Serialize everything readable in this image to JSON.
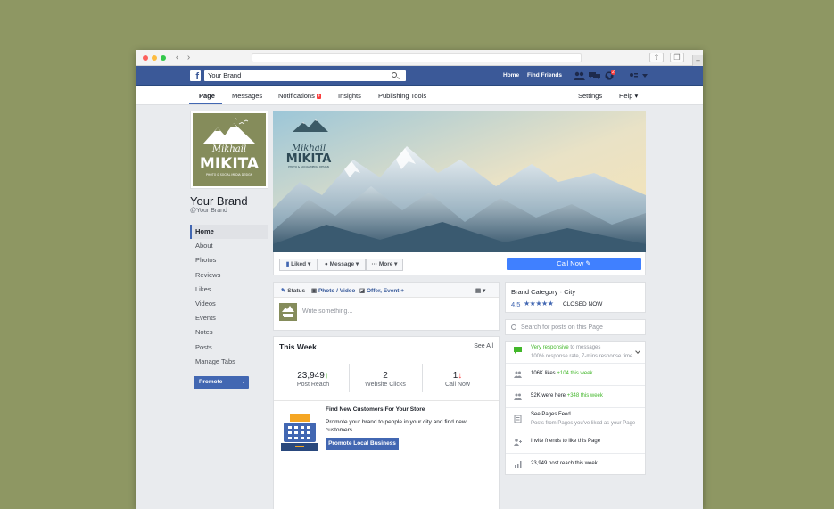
{
  "browser": {
    "tb_back": "‹",
    "tb_forward": "›",
    "tb_share": "⇧",
    "tb_tabs": "❐",
    "tb_new_tab": "+"
  },
  "fb_header": {
    "logo": "f",
    "search_value": "Your Brand",
    "nav_home": "Home",
    "nav_find_friends": "Find Friends",
    "globe_badge": "2",
    "colors": {
      "bar": "#3b5998",
      "accent": "#4267b2",
      "call_now": "#4080ff"
    }
  },
  "page_tabs": {
    "page": "Page",
    "messages": "Messages",
    "notifications": "Notifications",
    "notifications_count": "4",
    "insights": "Insights",
    "publishing_tools": "Publishing Tools",
    "settings": "Settings",
    "help": "Help ▾"
  },
  "profile": {
    "logo_first": "Mikhail",
    "logo_last": "MIKITA",
    "logo_tagline": "PHOTO & SOCIAL MEDIA DESIGN",
    "name": "Your Brand",
    "handle": "@Your Brand"
  },
  "left_nav": [
    "Home",
    "About",
    "Photos",
    "Reviews",
    "Likes",
    "Videos",
    "Events",
    "Notes",
    "Posts",
    "Manage Tabs"
  ],
  "promote_button": "Promote",
  "cover": {
    "logo_first": "Mikhail",
    "logo_last": "MIKITA",
    "logo_tagline": "PHOTO & SOCIAL MEDIA DESIGN"
  },
  "actions": {
    "liked": "Liked",
    "message": "Message",
    "more": "More",
    "call_now": "Call Now"
  },
  "composer": {
    "status": "Status",
    "photo_video": "Photo / Video",
    "offer_event": "Offer, Event +",
    "placeholder": "Write something..."
  },
  "this_week": {
    "title": "This Week",
    "see_all": "See All",
    "stats": [
      {
        "value": "23,949",
        "label": "Post Reach",
        "trend": "↑"
      },
      {
        "value": "2",
        "label": "Website Clicks",
        "trend": ""
      },
      {
        "value": "1",
        "label": "Call Now",
        "trend": "↓"
      }
    ],
    "find_title": "Find New Customers For Your Store",
    "find_desc": "Promote your brand to people in your city and find new customers",
    "promote_local": "Promote Local Business"
  },
  "info": {
    "category": "Brand Category",
    "separator": "·",
    "city": "City",
    "rating": "4.5",
    "stars": "★★★★★",
    "status": "CLOSED NOW"
  },
  "post_search_placeholder": "Search for posts on this Page",
  "side_list": {
    "responsive": "Very responsive",
    "responsive_suffix": " to messages",
    "response_detail": "100% response rate, 7-mins response time",
    "likes": "106K likes ",
    "likes_delta": "+104 this week",
    "here": "52K were here ",
    "here_delta": "+348 this week",
    "feed_title": "See Pages Feed",
    "feed_desc": "Posts from Pages you've liked as your Page",
    "invite": "Invite friends to like this Page",
    "reach": "23,949 post reach this week"
  }
}
